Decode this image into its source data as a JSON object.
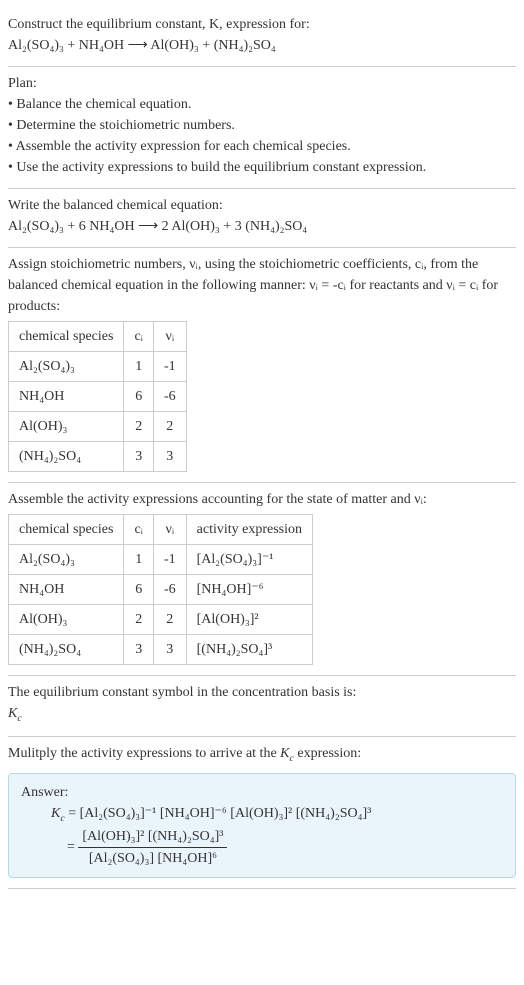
{
  "intro": {
    "line1": "Construct the equilibrium constant, K, expression for:",
    "equation": "Al₂(SO₄)₃ + NH₄OH ⟶ Al(OH)₃ + (NH₄)₂SO₄"
  },
  "plan": {
    "heading": "Plan:",
    "items": [
      "• Balance the chemical equation.",
      "• Determine the stoichiometric numbers.",
      "• Assemble the activity expression for each chemical species.",
      "• Use the activity expressions to build the equilibrium constant expression."
    ]
  },
  "balanced": {
    "line1": "Write the balanced chemical equation:",
    "equation": "Al₂(SO₄)₃ + 6 NH₄OH ⟶ 2 Al(OH)₃ + 3 (NH₄)₂SO₄"
  },
  "stoich": {
    "text": "Assign stoichiometric numbers, νᵢ, using the stoichiometric coefficients, cᵢ, from the balanced chemical equation in the following manner: νᵢ = -cᵢ for reactants and νᵢ = cᵢ for products:",
    "headers": [
      "chemical species",
      "cᵢ",
      "νᵢ"
    ],
    "rows": [
      [
        "Al₂(SO₄)₃",
        "1",
        "-1"
      ],
      [
        "NH₄OH",
        "6",
        "-6"
      ],
      [
        "Al(OH)₃",
        "2",
        "2"
      ],
      [
        "(NH₄)₂SO₄",
        "3",
        "3"
      ]
    ]
  },
  "activity": {
    "text": "Assemble the activity expressions accounting for the state of matter and νᵢ:",
    "headers": [
      "chemical species",
      "cᵢ",
      "νᵢ",
      "activity expression"
    ],
    "rows": [
      [
        "Al₂(SO₄)₃",
        "1",
        "-1",
        "[Al₂(SO₄)₃]⁻¹"
      ],
      [
        "NH₄OH",
        "6",
        "-6",
        "[NH₄OH]⁻⁶"
      ],
      [
        "Al(OH)₃",
        "2",
        "2",
        "[Al(OH)₃]²"
      ],
      [
        "(NH₄)₂SO₄",
        "3",
        "3",
        "[(NH₄)₂SO₄]³"
      ]
    ]
  },
  "symbol": {
    "line1": "The equilibrium constant symbol in the concentration basis is:",
    "line2": "K𞁞"
  },
  "multiply": {
    "text": "Mulitply the activity expressions to arrive at the K𞁞 expression:"
  },
  "answer": {
    "label": "Answer:",
    "line1": "K𞁞 = [Al₂(SO₄)₃]⁻¹ [NH₄OH]⁻⁶ [Al(OH)₃]² [(NH₄)₂SO₄]³",
    "numerator": "[Al(OH)₃]² [(NH₄)₂SO₄]³",
    "denominator": "[Al₂(SO₄)₃] [NH₄OH]⁶"
  }
}
